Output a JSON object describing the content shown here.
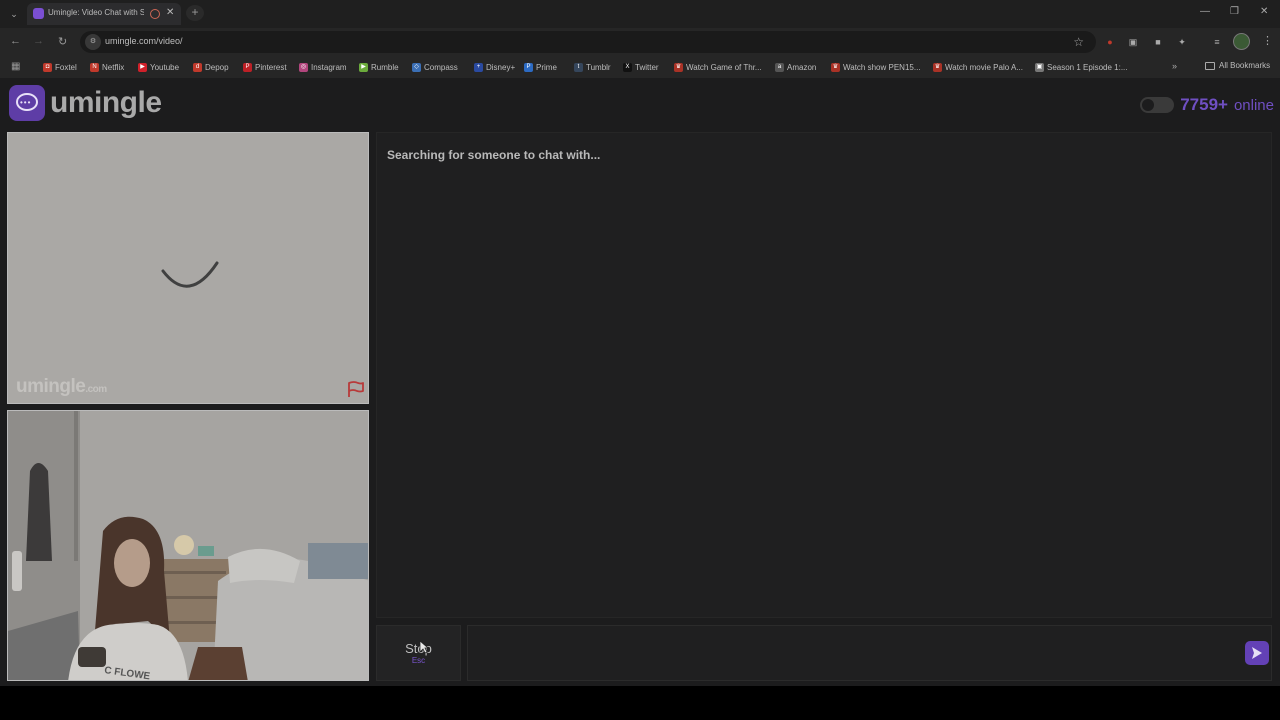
{
  "browser": {
    "tab_title": "Umingle: Video Chat with S",
    "url": "umingle.com/video/",
    "site_info_label": "",
    "bookmarks": [
      {
        "label": "Foxtel",
        "color": "#c0392b"
      },
      {
        "label": "Netflix",
        "color": "#c0392b"
      },
      {
        "label": "Youtube",
        "color": "#d0202a"
      },
      {
        "label": "Depop",
        "color": "#c0392b"
      },
      {
        "label": "Pinterest",
        "color": "#bd2026"
      },
      {
        "label": "Instagram",
        "color": "#b2467d"
      },
      {
        "label": "Rumble",
        "color": "#6bab3c"
      },
      {
        "label": "Compass",
        "color": "#3b6fb5"
      },
      {
        "label": "Disney+",
        "color": "#2a4aa0"
      },
      {
        "label": "Prime",
        "color": "#2c6ac2"
      },
      {
        "label": "Tumblr",
        "color": "#35465c"
      },
      {
        "label": "Twitter",
        "color": "#111111"
      },
      {
        "label": "Watch Game of Thr...",
        "color": "#a93226"
      },
      {
        "label": "Amazon",
        "color": "#555555"
      },
      {
        "label": "Watch show PEN15...",
        "color": "#a93226"
      },
      {
        "label": "Watch movie Palo A...",
        "color": "#a93226"
      },
      {
        "label": "Season 1 Episode 1:...",
        "color": "#777777"
      }
    ],
    "all_bookmarks": "All Bookmarks"
  },
  "site": {
    "logo_text": "umingle",
    "online_count": "7759+",
    "online_label": "online",
    "watermark": "umingle",
    "watermark_tld": ".com",
    "status_message": "Searching for someone to chat with...",
    "stop_label": "Stop",
    "stop_key": "Esc",
    "message_placeholder": "",
    "accent_color": "#6341b6"
  }
}
